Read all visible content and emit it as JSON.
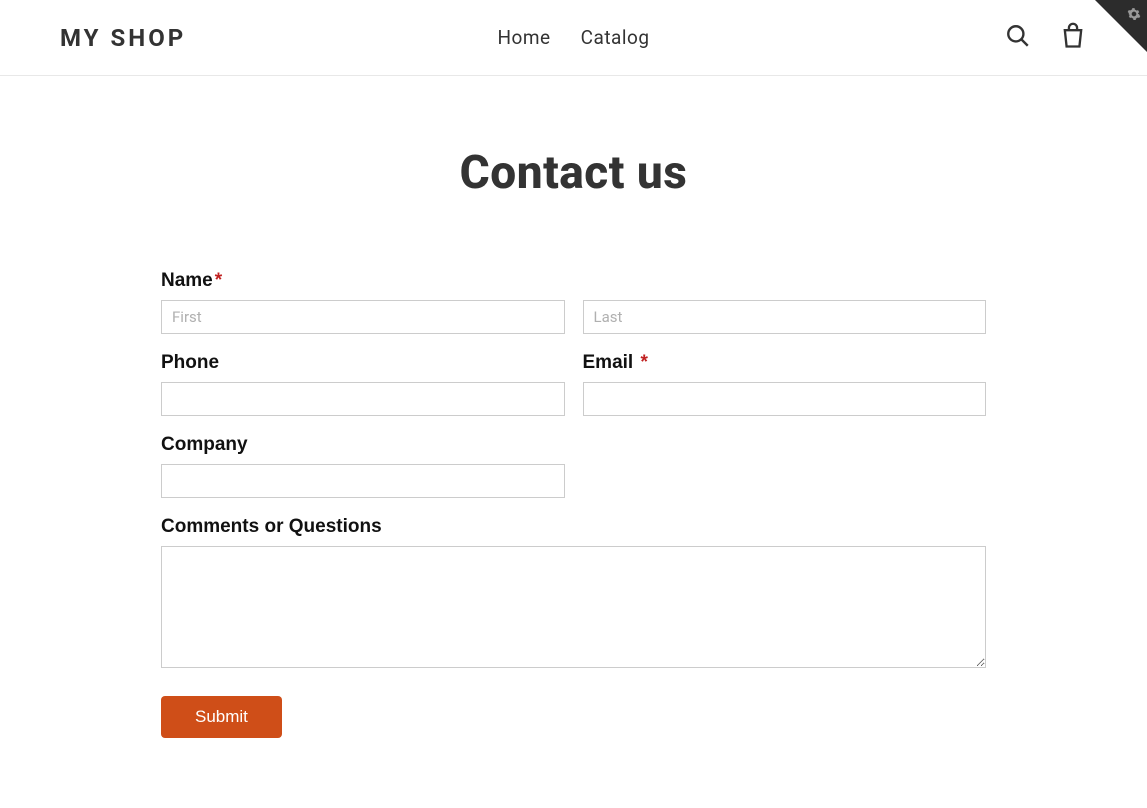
{
  "header": {
    "logo": "MY SHOP",
    "nav": {
      "home": "Home",
      "catalog": "Catalog"
    }
  },
  "page": {
    "title": "Contact us"
  },
  "form": {
    "name_label": "Name",
    "first_placeholder": "First",
    "last_placeholder": "Last",
    "phone_label": "Phone",
    "email_label": "Email",
    "company_label": "Company",
    "comments_label": "Comments or Questions",
    "required_mark": "*",
    "submit_label": "Submit"
  }
}
